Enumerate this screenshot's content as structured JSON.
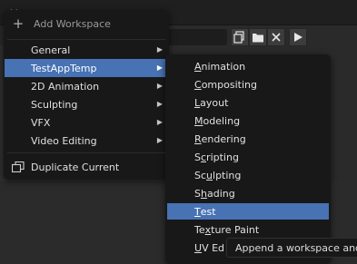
{
  "background": {
    "tab_close": "×",
    "file_buttons": [
      "copy-icon",
      "folder-icon",
      "clear-icon",
      "play-icon"
    ]
  },
  "menu": {
    "header": "Add Workspace",
    "items": [
      {
        "label": "General",
        "has_submenu": true
      },
      {
        "label": "TestAppTemp",
        "has_submenu": true,
        "active": true
      },
      {
        "label": "2D Animation",
        "has_submenu": true
      },
      {
        "label": "Sculpting",
        "has_submenu": true
      },
      {
        "label": "VFX",
        "has_submenu": true
      },
      {
        "label": "Video Editing",
        "has_submenu": true
      }
    ],
    "duplicate": "Duplicate Current"
  },
  "submenu": {
    "items": [
      {
        "pre": "",
        "ul": "A",
        "post": "nimation"
      },
      {
        "pre": "",
        "ul": "C",
        "post": "ompositing"
      },
      {
        "pre": "",
        "ul": "L",
        "post": "ayout"
      },
      {
        "pre": "",
        "ul": "M",
        "post": "odeling"
      },
      {
        "pre": "",
        "ul": "R",
        "post": "endering"
      },
      {
        "pre": "S",
        "ul": "c",
        "post": "ripting"
      },
      {
        "pre": "Sc",
        "ul": "u",
        "post": "lpting"
      },
      {
        "pre": "S",
        "ul": "h",
        "post": "ading"
      },
      {
        "pre": "",
        "ul": "T",
        "post": "est",
        "active": true
      },
      {
        "pre": "Te",
        "ul": "x",
        "post": "ture Paint"
      },
      {
        "pre": "",
        "ul": "U",
        "post": "V Ed"
      }
    ]
  },
  "tooltip": "Append a workspace and m",
  "colors": {
    "accent": "#4772b3",
    "menu_bg": "#181818"
  }
}
